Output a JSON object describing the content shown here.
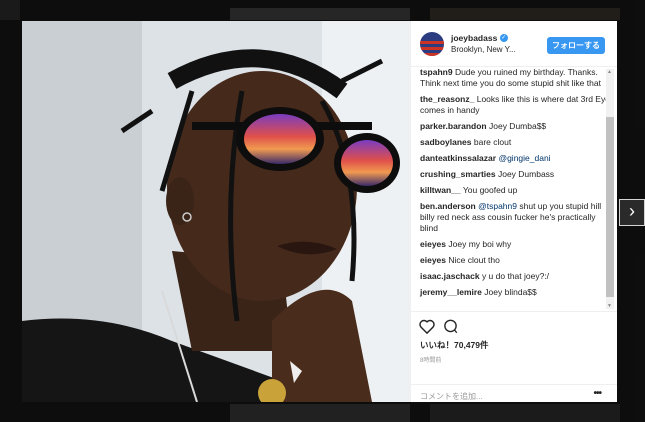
{
  "post": {
    "username": "joeybadass",
    "location": "Brooklyn, New Y...",
    "follow_label": "フォローする",
    "likes": "いいね！70,479件",
    "time_ago": "8時間前",
    "comment_placeholder": "コメントを追加...",
    "more_label": "•••"
  },
  "comments": [
    {
      "user": "tspahn9",
      "text": "Dude you ruined my birthday. Thanks. Think next time you do some stupid shit like that"
    },
    {
      "user": "the_reasonz_",
      "text": "Looks like this is where dat 3rd Eye comes in handy"
    },
    {
      "user": "parker.barandon",
      "text": "Joey Dumba$$"
    },
    {
      "user": "sadboylanes",
      "text": "bare clout"
    },
    {
      "user": "danteatkinssalazar",
      "mention": "@gingie_dani",
      "text": ""
    },
    {
      "user": "crushing_smarties",
      "text": "Joey Dumbass"
    },
    {
      "user": "killtwan__",
      "text": "You goofed up"
    },
    {
      "user": "ben.anderson",
      "mention": "@tspahn9",
      "text": "shut up you stupid hill billy red neck ass cousin fucker he's practically blind"
    },
    {
      "user": "eieyes",
      "text": "Joey my boi why"
    },
    {
      "user": "eieyes",
      "text": "Nice clout tho"
    },
    {
      "user": "isaac.jaschack",
      "text": "y u do that joey?:/"
    },
    {
      "user": "jeremy__lemire",
      "text": "Joey blinda$$"
    }
  ],
  "icons": {
    "verified": "verified-badge-icon",
    "like": "heart-icon",
    "comment": "comment-bubble-icon",
    "next": "chevron-right-icon"
  },
  "colors": {
    "accent": "#3897f0",
    "text": "#262626",
    "muted": "#999999"
  }
}
